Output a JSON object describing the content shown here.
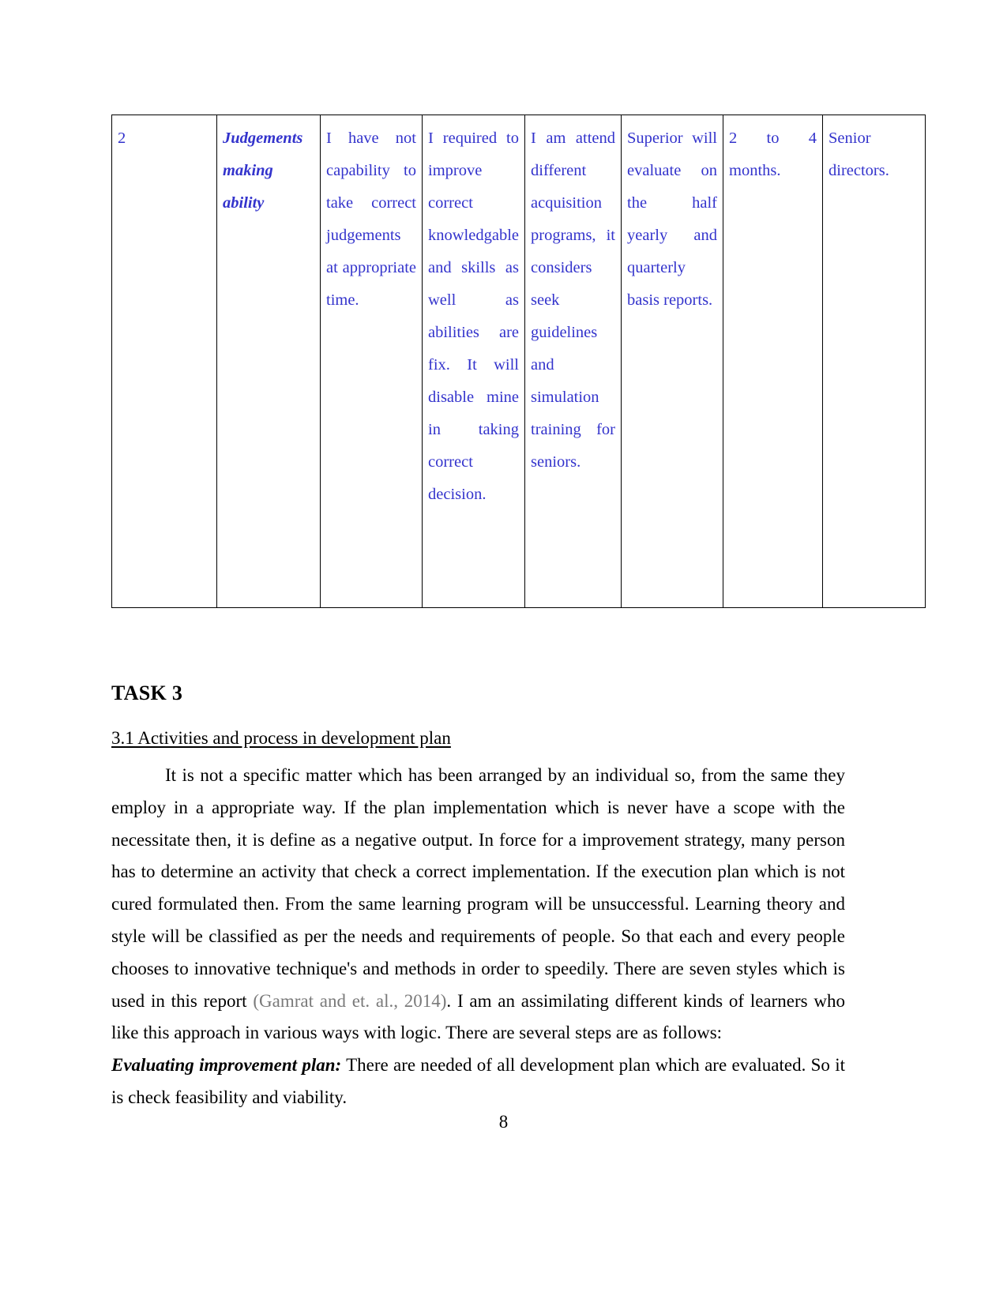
{
  "document": {
    "page_number": "8",
    "table": {
      "row_label": "2",
      "columns": [
        "2",
        "Judgements making ability",
        "I have not capability to take correct judgements at appropriate time.",
        "I required to improve correct knowledgable and skills as well as abilities are fix. It will disable mine in taking correct decision.",
        "I am attend different acquisition programs, it considers seek guidelines and simulation training for seniors.",
        "Superior will evaluate on the half yearly and quarterly basis reports.",
        "2 to 4 months.",
        "Senior directors."
      ],
      "cells": {
        "serial": "2",
        "skill": "Judgements making ability",
        "current_proficiency": "I have not capability to take correct judgements at appropriate time.",
        "development_need": "I required to improve correct knowledgable and skills as well as abilities are fix. It will disable mine in taking correct decision.",
        "activities": "I am attend different acquisition programs, it considers seek guidelines and simulation training for seniors.",
        "review": "Superior will evaluate on the half yearly and quarterly basis reports.",
        "timeframe": "2 to 4 months.",
        "responsible": "Senior directors."
      }
    },
    "task_title": "TASK 3",
    "sub_heading": "3.1 Activities and process in development plan",
    "paragraph_1_part_a": "It is not a specific matter which has been arranged by an individual so, from the same they employ in a appropriate way. If the plan implementation which is never have a scope with the necessitate then, it is define as a negative output. In force for a improvement strategy, many person has to determine an activity that check a correct implementation. If the execution plan which is not cured formulated then. From the same learning program will be unsuccessful. Learning theory and style will be classified as per the needs and requirements of people. So that each and every people chooses to innovative technique's and methods in order to speedily. There are seven styles which is used in this report ",
    "paragraph_1_citation": "(Gamrat and et. al., 2014)",
    "paragraph_1_part_b": ". I am an assimilating different kinds of learners who like this approach in various ways with logic. There are several steps are as follows:",
    "paragraph_2_lead": "Evaluating improvement plan:",
    "paragraph_2_body": " There are needed of all development plan which are evaluated. So it is check feasibility and viability."
  },
  "colors": {
    "table_text": "#3333cc",
    "body_text": "#000000",
    "citation_text": "#7a7a7a",
    "border": "#000000",
    "page_background": "#ffffff"
  }
}
